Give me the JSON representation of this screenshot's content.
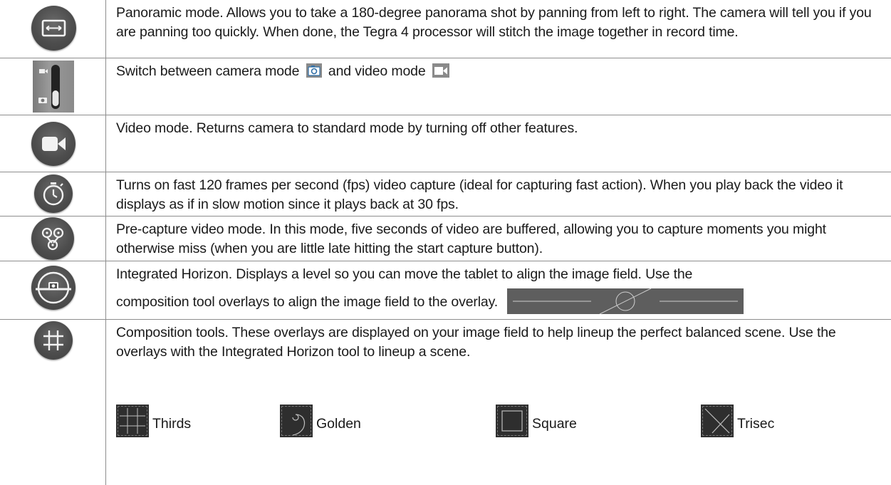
{
  "rows": [
    {
      "icon": "panorama-icon",
      "text": "Panoramic mode. Allows you to take a 180-degree panorama shot by panning from left to right. The camera will tell you if you are panning too quickly. When done, the Tegra 4 processor will stitch the image together in record time."
    },
    {
      "icon": "camera-video-switch-icon",
      "text_before": "Switch between camera mode",
      "text_middle": "and video mode",
      "inline_icons": [
        "camera-icon",
        "video-icon"
      ]
    },
    {
      "icon": "video-camera-icon",
      "text": "Video mode. Returns camera to standard mode by turning off other features."
    },
    {
      "icon": "stopwatch-icon",
      "text": "Turns on fast 120 frames per second (fps) video capture (ideal for capturing fast action). When you play back the video it displays as if in slow motion since it plays back at 30 fps."
    },
    {
      "icon": "pre-capture-icon",
      "text": "Pre-capture video mode. In this mode, five seconds of video are buffered, allowing you to capture moments you might otherwise miss (when you are little late hitting the start capture button)."
    },
    {
      "icon": "horizon-level-icon",
      "text_line1": "Integrated Horizon. Displays a level so you can move the tablet to align the image field. Use the",
      "text_line2": "composition tool overlays to align the image field to the overlay.",
      "inline_icons": [
        "horizon-overlay-icon"
      ]
    },
    {
      "icon": "grid-icon",
      "text": "Composition tools. These overlays are displayed on your image field to help lineup the perfect balanced scene. Use the overlays with the Integrated Horizon tool to lineup a scene.",
      "overlays": [
        {
          "label": "Thirds",
          "icon": "thirds-overlay-icon"
        },
        {
          "label": "Golden",
          "icon": "golden-spiral-overlay-icon"
        },
        {
          "label": "Square",
          "icon": "square-overlay-icon"
        },
        {
          "label": "Trisec",
          "icon": "trisec-overlay-icon"
        }
      ]
    }
  ],
  "colors": {
    "icon_bg": "#4d4d4d",
    "rule": "#8e8e8e",
    "text": "#1a1a1a",
    "camera_blue": "#2f6fa8"
  }
}
